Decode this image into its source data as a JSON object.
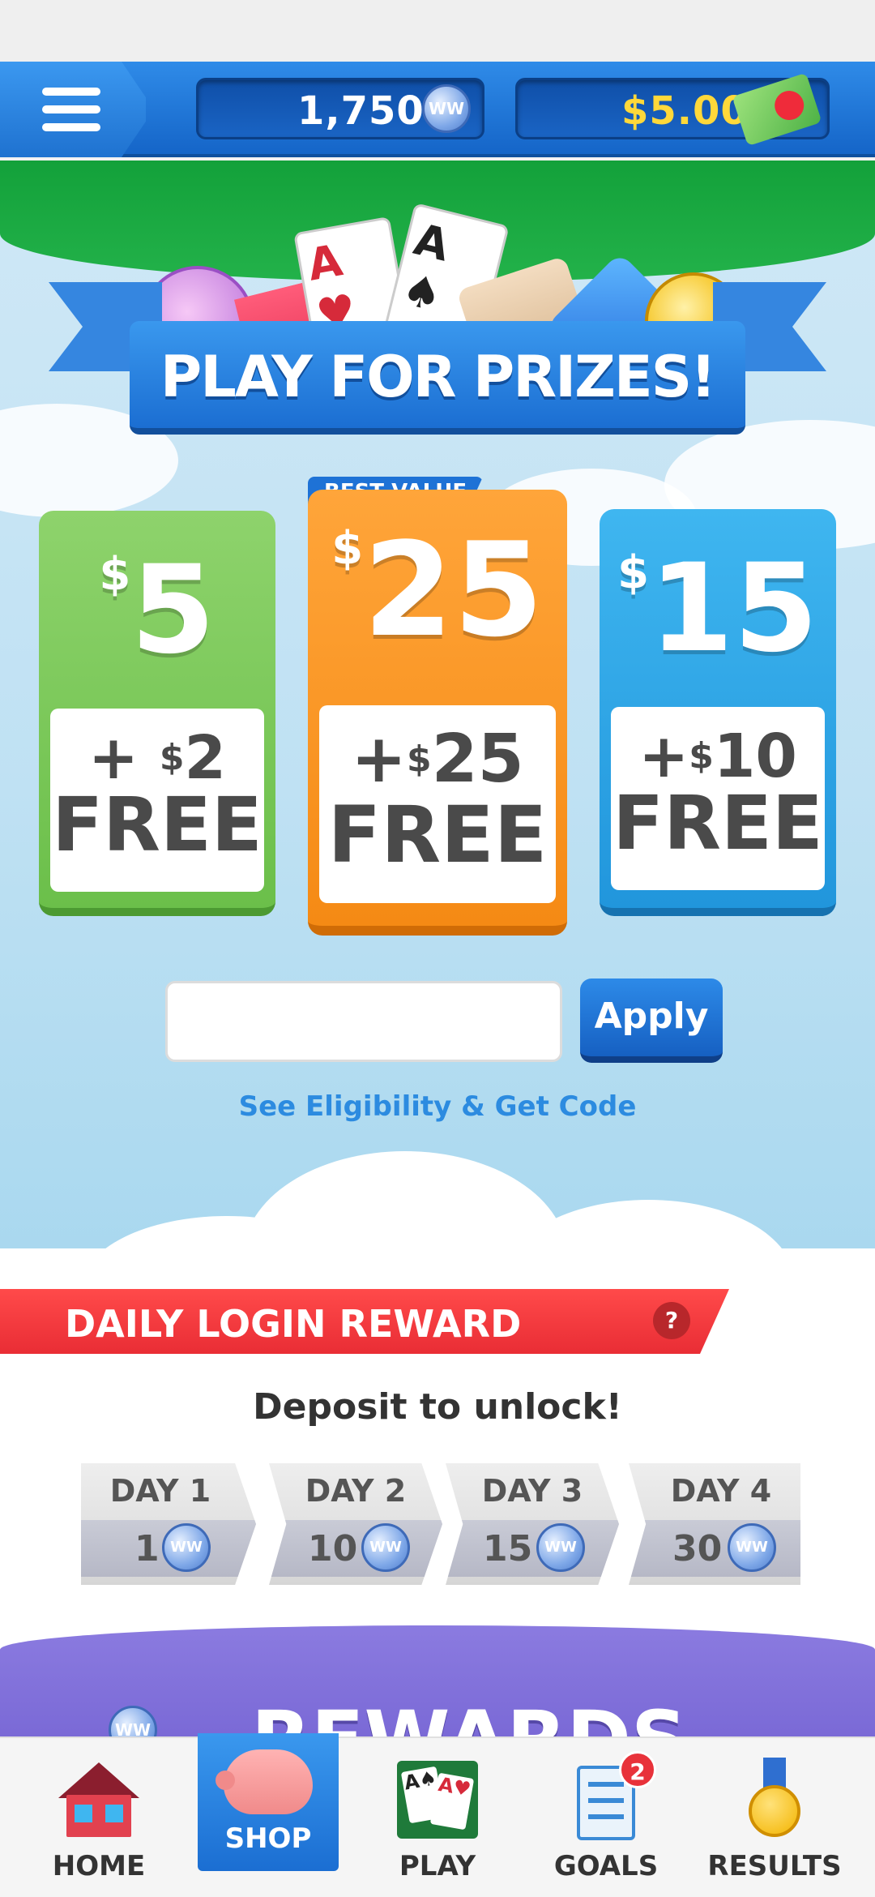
{
  "top_bar": {
    "coins": "1,750",
    "cash": "$5.00",
    "coin_symbol": "WW"
  },
  "banner": {
    "title": "PLAY FOR PRIZES!",
    "game_icons": [
      "bingo-ball-icon",
      "watermelon-icon",
      "ace-of-hearts-card-icon",
      "ace-of-spades-card-icon",
      "letter-tile-icon",
      "blue-gem-icon",
      "gold-coin-icon"
    ]
  },
  "offers": [
    {
      "currency": "$",
      "amount": "5",
      "bonus_prefix": "+ ",
      "bonus_currency": "$",
      "bonus_amount": "2",
      "bonus_word": "FREE",
      "color": "#7cc45c"
    },
    {
      "badge": "BEST VALUE",
      "currency": "$",
      "amount": "25",
      "bonus_prefix": "+",
      "bonus_currency": "$",
      "bonus_amount": "25",
      "bonus_word": "FREE",
      "color": "#f7931e"
    },
    {
      "currency": "$",
      "amount": "15",
      "bonus_prefix": "+",
      "bonus_currency": "$",
      "bonus_amount": "10",
      "bonus_word": "FREE",
      "color": "#2fa6e6"
    }
  ],
  "promo": {
    "input_value": "",
    "input_placeholder": "",
    "apply_label": "Apply",
    "eligibility_link": "See Eligibility & Get Code"
  },
  "daily_login": {
    "title": "DAILY LOGIN REWARD",
    "help_label": "?",
    "subtitle": "Deposit to unlock!",
    "days": [
      {
        "label": "DAY 1",
        "value": "1"
      },
      {
        "label": "DAY 2",
        "value": "10"
      },
      {
        "label": "DAY 3",
        "value": "15"
      },
      {
        "label": "DAY 4",
        "value": "30"
      }
    ]
  },
  "rewards": {
    "title": "REWARDS"
  },
  "nav": {
    "items": [
      {
        "label": "HOME",
        "icon": "house-icon"
      },
      {
        "label": "SHOP",
        "icon": "piggy-bank-icon",
        "active": true
      },
      {
        "label": "PLAY",
        "icon": "playing-cards-icon"
      },
      {
        "label": "GOALS",
        "icon": "checklist-icon",
        "badge": "2"
      },
      {
        "label": "RESULTS",
        "icon": "medal-icon"
      }
    ]
  },
  "colors": {
    "primary_blue": "#1b6ed2",
    "green_banner": "#13a13a",
    "daily_red": "#e92d35",
    "link_blue": "#2c8be0"
  }
}
